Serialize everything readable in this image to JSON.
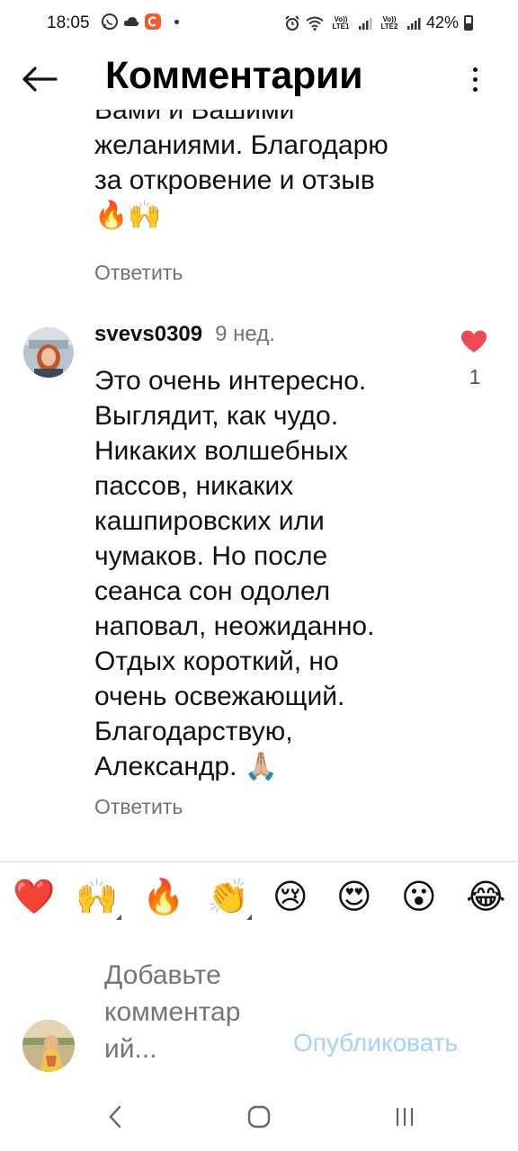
{
  "status_bar": {
    "time": "18:05",
    "battery": "42%",
    "sim1_label": "Vo)) LTE1",
    "sim2_label": "Vo)) LTE2"
  },
  "header": {
    "title": "Комментарии"
  },
  "previous_comment": {
    "text_lines": [
      "Вами и Вашими",
      "желаниями. Благодарю",
      "за откровение и отзыв"
    ],
    "emoji": "🔥🙌",
    "reply_label": "Ответить"
  },
  "comment": {
    "username": "svevs0309",
    "time_ago": "9 нед.",
    "text_lines": [
      "Это очень интересно.",
      "Выглядит, как чудо.",
      "Никаких волшебных",
      "пассов, никаких",
      "кашпировских или",
      "чумаков. Но после",
      "сеанса сон одолел",
      "наповал, неожиданно.",
      "Отдых короткий, но",
      "очень освежающий.",
      "Благодарствую,",
      "Александр. 🙏🏼"
    ],
    "likes": "1",
    "reply_label": "Ответить"
  },
  "emoji_bar": {
    "emojis": [
      "❤️",
      "🙌",
      "🔥",
      "👏",
      "😢",
      "😍",
      "😮",
      "😂"
    ]
  },
  "add_comment": {
    "placeholder": "Добавьте комментар ий...",
    "publish_label": "Опубликовать"
  },
  "colors": {
    "accent_light_blue": "#9fd5f8",
    "like_red": "#ed4956",
    "secondary_text": "#737373"
  }
}
